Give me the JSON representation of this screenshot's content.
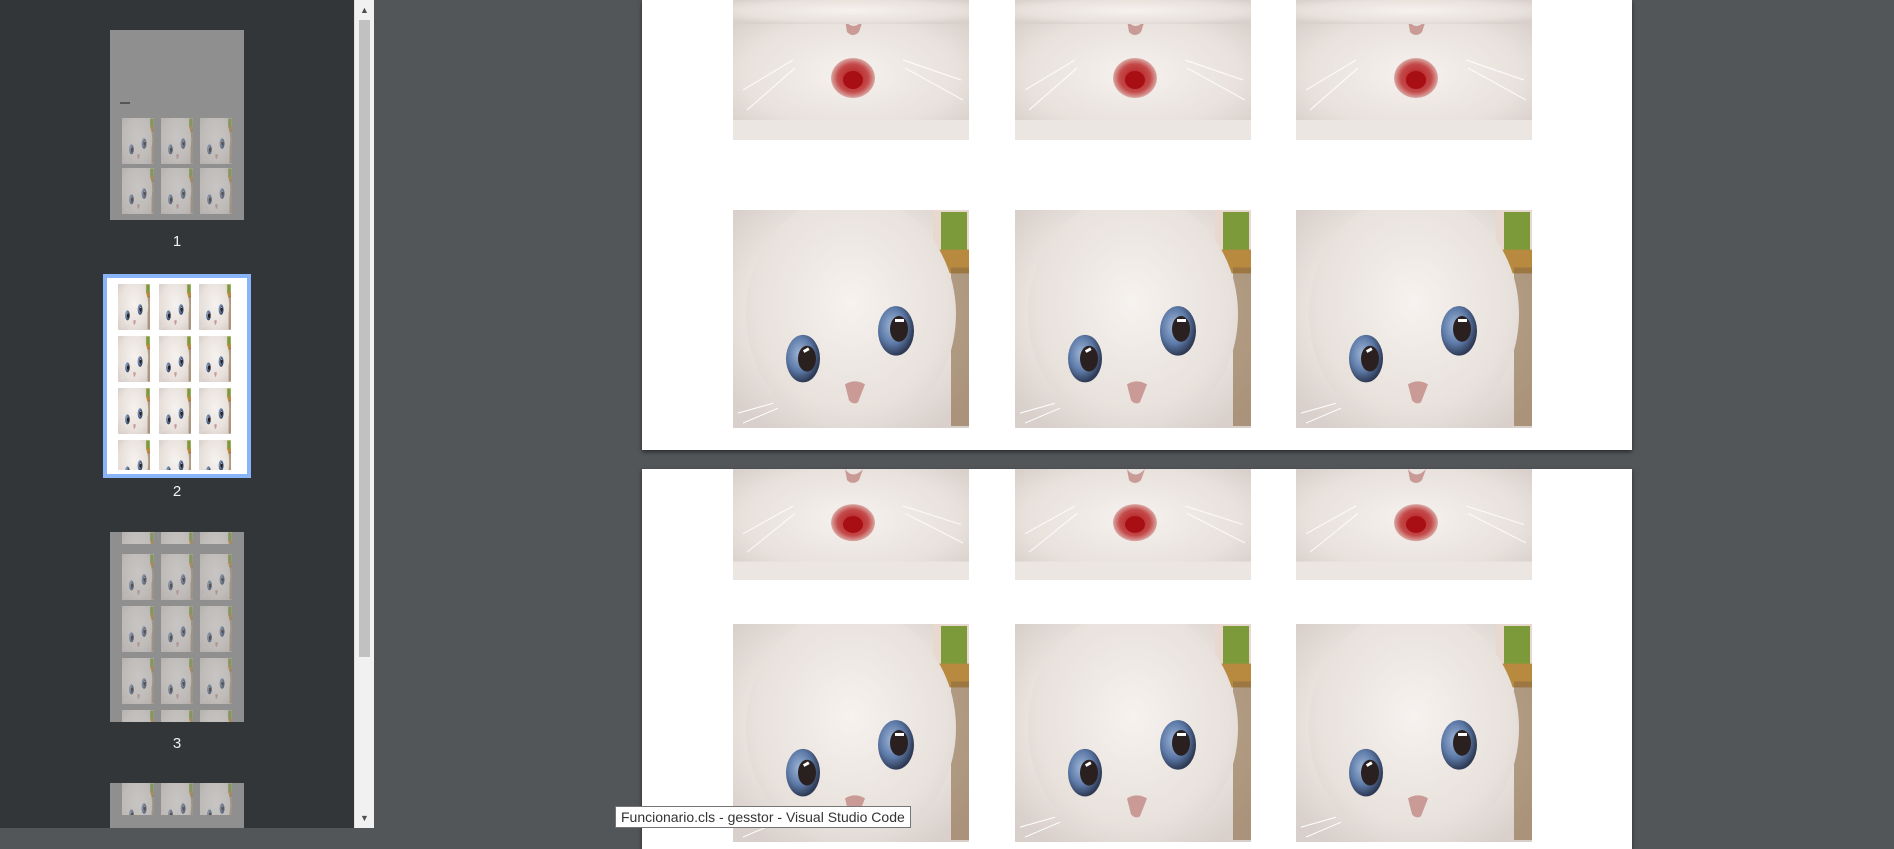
{
  "sidebar": {
    "thumbnails": [
      {
        "label": "1",
        "state": "normal"
      },
      {
        "label": "2",
        "state": "selected"
      },
      {
        "label": "3",
        "state": "normal"
      },
      {
        "label": "",
        "state": "normal"
      }
    ]
  },
  "tooltip": {
    "text": "Funcionario.cls - gesstor - Visual Studio Code"
  },
  "colors": {
    "sidebar_bg": "#323639",
    "viewer_bg": "#525659",
    "selected_border": "#8ab4f8"
  },
  "icons": [
    "scroll-up-arrow-icon",
    "scroll-down-arrow-icon",
    "cat-photo"
  ]
}
